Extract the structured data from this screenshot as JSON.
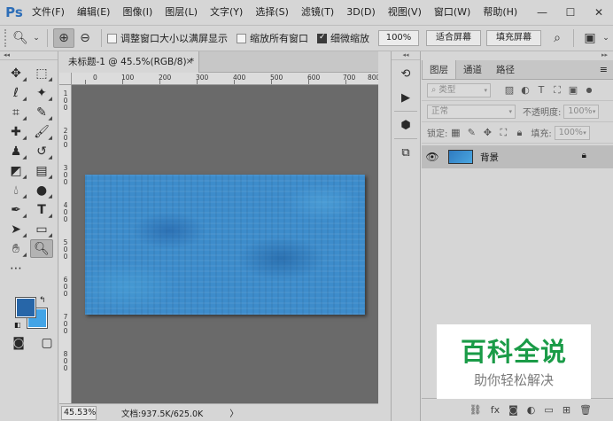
{
  "app": {
    "logo": "Ps"
  },
  "menu": [
    "文件(F)",
    "编辑(E)",
    "图像(I)",
    "图层(L)",
    "文字(Y)",
    "选择(S)",
    "滤镜(T)",
    "3D(D)",
    "视图(V)",
    "窗口(W)",
    "帮助(H)"
  ],
  "window_controls": {
    "minimize": "—",
    "maximize": "☐",
    "close": "✕"
  },
  "options": {
    "resize_windows_label": "调整窗口大小以满屏显示",
    "resize_windows_checked": false,
    "zoom_all_label": "缩放所有窗口",
    "zoom_all_checked": false,
    "scrubby_zoom_label": "细微缩放",
    "scrubby_zoom_checked": true,
    "zoom_value": "100%",
    "fit_screen_label": "适合屏幕",
    "fill_screen_label": "填充屏幕"
  },
  "document": {
    "tab_title": "未标题-1 @ 45.5%(RGB/8) *",
    "close_glyph": "×",
    "ruler_h": [
      "0",
      "100",
      "200",
      "300",
      "400",
      "500",
      "600",
      "700",
      "800"
    ],
    "ruler_v": [
      "1",
      "0",
      "0",
      "2",
      "0",
      "0",
      "3",
      "0",
      "0",
      "4",
      "0",
      "0",
      "5",
      "0",
      "0",
      "6",
      "0",
      "0",
      "7",
      "0",
      "0",
      "8",
      "0",
      "0"
    ]
  },
  "status": {
    "zoom": "45.53%",
    "doc_info": "文档:937.5K/625.0K",
    "arrow": "〉"
  },
  "colors": {
    "foreground": "#2766a8",
    "background": "#43a4e6"
  },
  "layers_panel": {
    "tabs": [
      "图层",
      "通道",
      "路径"
    ],
    "filter_kind": "类型",
    "blend_mode": "正常",
    "opacity_label": "不透明度:",
    "opacity_value": "100%",
    "lock_label": "锁定:",
    "fill_label": "填充:",
    "fill_value": "100%",
    "layers": [
      {
        "name": "背景",
        "visible": true,
        "locked": true
      }
    ]
  },
  "watermark": {
    "title": "百科全说",
    "subtitle": "助你轻松解决"
  }
}
